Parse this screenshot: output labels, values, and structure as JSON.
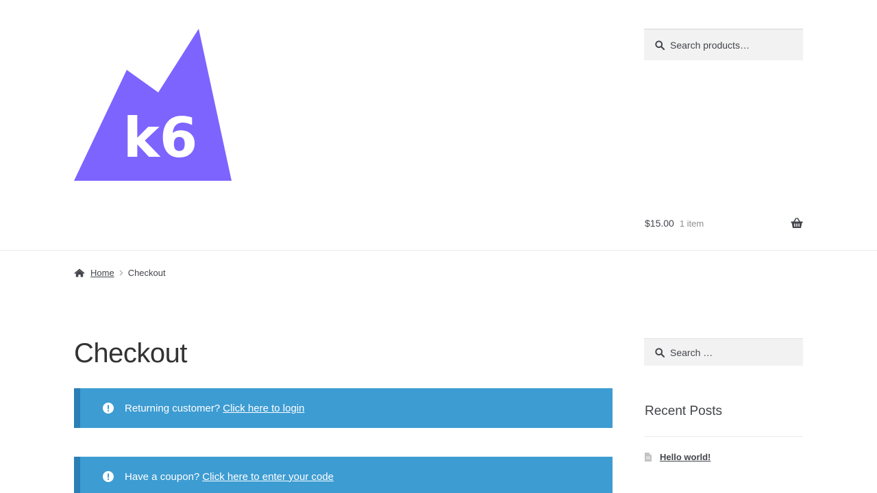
{
  "header": {
    "logo_text": "k6",
    "search_placeholder": "Search products…",
    "cart": {
      "amount": "$15.00",
      "count": "1 item"
    }
  },
  "breadcrumb": {
    "home": "Home",
    "current": "Checkout"
  },
  "page": {
    "title": "Checkout"
  },
  "notices": {
    "login": {
      "text": "Returning customer?",
      "link": "Click here to login"
    },
    "coupon": {
      "text": "Have a coupon?",
      "link": "Click here to enter your code"
    }
  },
  "sidebar": {
    "search_placeholder": "Search …",
    "recent_posts_title": "Recent Posts",
    "posts": [
      "Hello world!"
    ]
  },
  "colors": {
    "brand": "#7d64ff",
    "notice": "#3d9cd2",
    "notice_border": "#2a7fb4"
  },
  "icons": [
    "search-icon",
    "basket-icon",
    "home-icon",
    "chevron-right-icon",
    "info-icon",
    "document-icon"
  ]
}
